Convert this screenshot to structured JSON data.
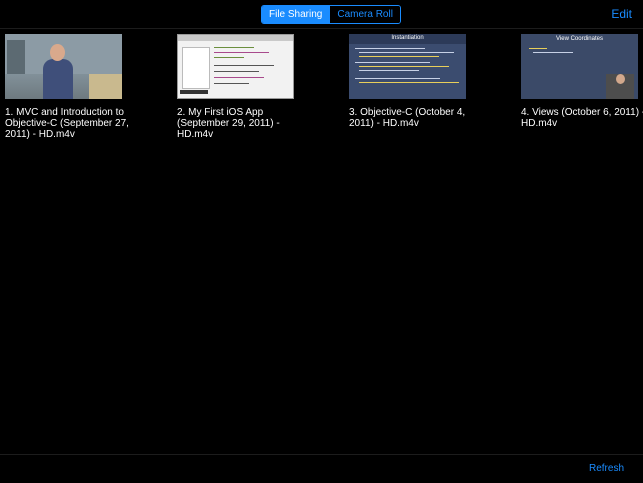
{
  "toolbar": {
    "segments": [
      "File Sharing",
      "Camera Roll"
    ],
    "selected_segment": "File Sharing",
    "edit_label": "Edit"
  },
  "videos": [
    {
      "title": "1. MVC and Introduction to Objective-C (September 27, 2011) - HD.m4v"
    },
    {
      "title": "2. My First iOS App (September 29, 2011) - HD.m4v"
    },
    {
      "title": "3. Objective-C (October 4, 2011) - HD.m4v",
      "slide_title": "Instantiation"
    },
    {
      "title": "4. Views (October 6, 2011) - HD.m4v",
      "slide_title": "View Coordinates"
    }
  ],
  "footer": {
    "refresh_label": "Refresh"
  },
  "colors": {
    "accent": "#1a8cff",
    "background": "#000000",
    "text": "#ffffff"
  }
}
